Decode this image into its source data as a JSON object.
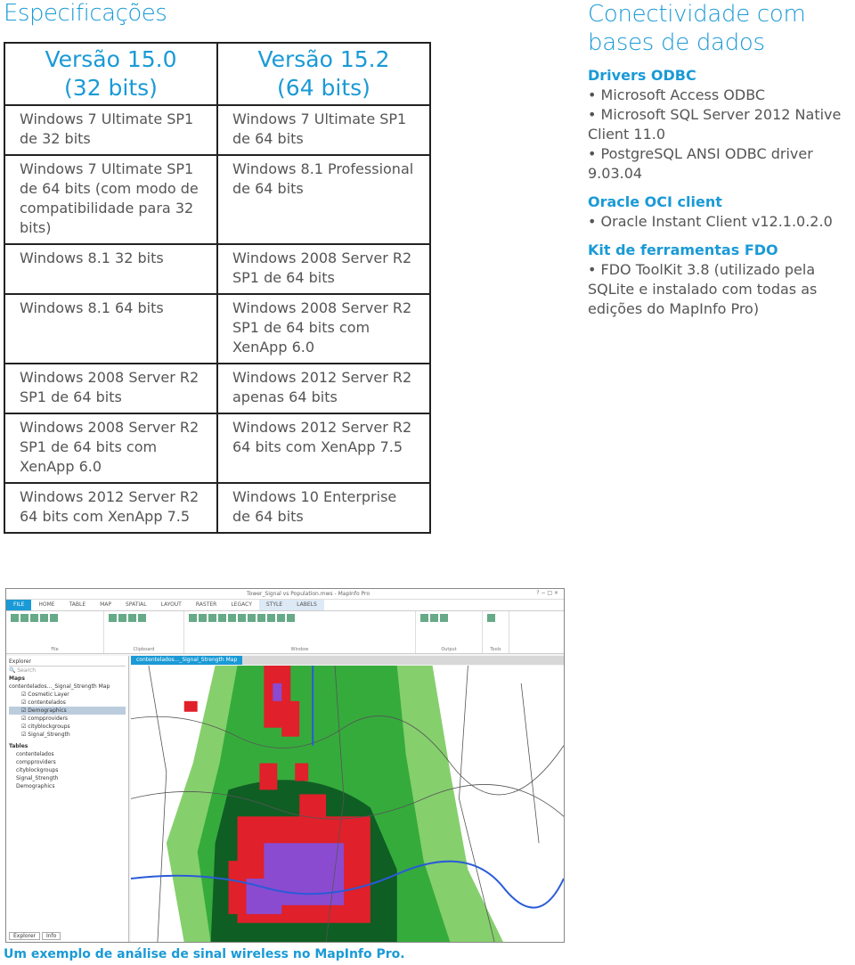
{
  "title": "Especificações",
  "spec_table": {
    "headers": [
      "Versão 15.0\n(32 bits)",
      "Versão 15.2\n(64 bits)"
    ],
    "header_lines": [
      [
        "Versão 15.0",
        "(32 bits)"
      ],
      [
        "Versão 15.2",
        "(64 bits)"
      ]
    ],
    "rows": [
      [
        "Windows 7 Ultimate SP1 de 32 bits",
        "Windows 7 Ultimate SP1 de 64 bits"
      ],
      [
        "Windows 7 Ultimate SP1 de 64 bits (com modo de compatibilidade para 32 bits)",
        "Windows 8.1 Professional de 64 bits"
      ],
      [
        "Windows 8.1 32 bits",
        "Windows 2008 Server R2 SP1 de 64 bits"
      ],
      [
        "Windows 8.1 64 bits",
        "Windows 2008 Server R2 SP1 de 64 bits com XenApp 6.0"
      ],
      [
        "Windows 2008 Server R2 SP1 de 64 bits",
        "Windows 2012 Server R2 apenas 64 bits"
      ],
      [
        "Windows 2008 Server R2 SP1 de 64 bits com XenApp 6.0",
        "Windows 2012 Server R2 64 bits com XenApp 7.5"
      ],
      [
        "Windows 2012 Server R2 64 bits com XenApp 7.5",
        "Windows 10 Enterprise de 64 bits"
      ]
    ]
  },
  "connectivity": {
    "title": "Conectividade com bases de dados",
    "sections": [
      {
        "heading": "Drivers ODBC",
        "items": [
          "Microsoft Access ODBC",
          "Microsoft SQL Server 2012 Native Client 11.0",
          "PostgreSQL ANSI ODBC driver 9.03.04"
        ]
      },
      {
        "heading": "Oracle OCI client",
        "items": [
          "Oracle Instant Client v12.1.0.2.0"
        ]
      },
      {
        "heading": "Kit de ferramentas FDO",
        "items": [
          "FDO ToolKit 3.8 (utilizado pela SQLite e instalado com todas as edições do MapInfo Pro)"
        ]
      }
    ]
  },
  "screenshot": {
    "window_title": "Tower_Signal vs Population.mws - MapInfo Pro",
    "tabs": [
      "FILE",
      "HOME",
      "TABLE",
      "MAP",
      "SPATIAL",
      "LAYOUT",
      "RASTER",
      "LEGACY",
      "STYLE",
      "LABELS"
    ],
    "groups": [
      "File",
      "Clipboard",
      "Window",
      "Output",
      "Tools"
    ],
    "explorer_title": "Explorer",
    "map_tab": "contentelados..._Signal_Strength Map",
    "layers": [
      "Cosmetic Layer",
      "contentelados",
      "Demographics",
      "compproviders",
      "cityblockgroups",
      "Signal_Strength"
    ],
    "tables": [
      "contentelados",
      "compproviders",
      "cityblockgroups",
      "Signal_Strength",
      "Demographics"
    ],
    "bottom_tabs": [
      "Explorer",
      "Info"
    ]
  },
  "caption": "Um exemplo de análise de sinal wireless no MapInfo Pro.",
  "colors": {
    "accent": "#1a9ad6",
    "light_green": "#7cc96a",
    "mid_green": "#2fa83a",
    "dark_green": "#0e5a22",
    "red": "#e0202a",
    "purple": "#8a4bd0",
    "river": "#2a5bd7"
  }
}
